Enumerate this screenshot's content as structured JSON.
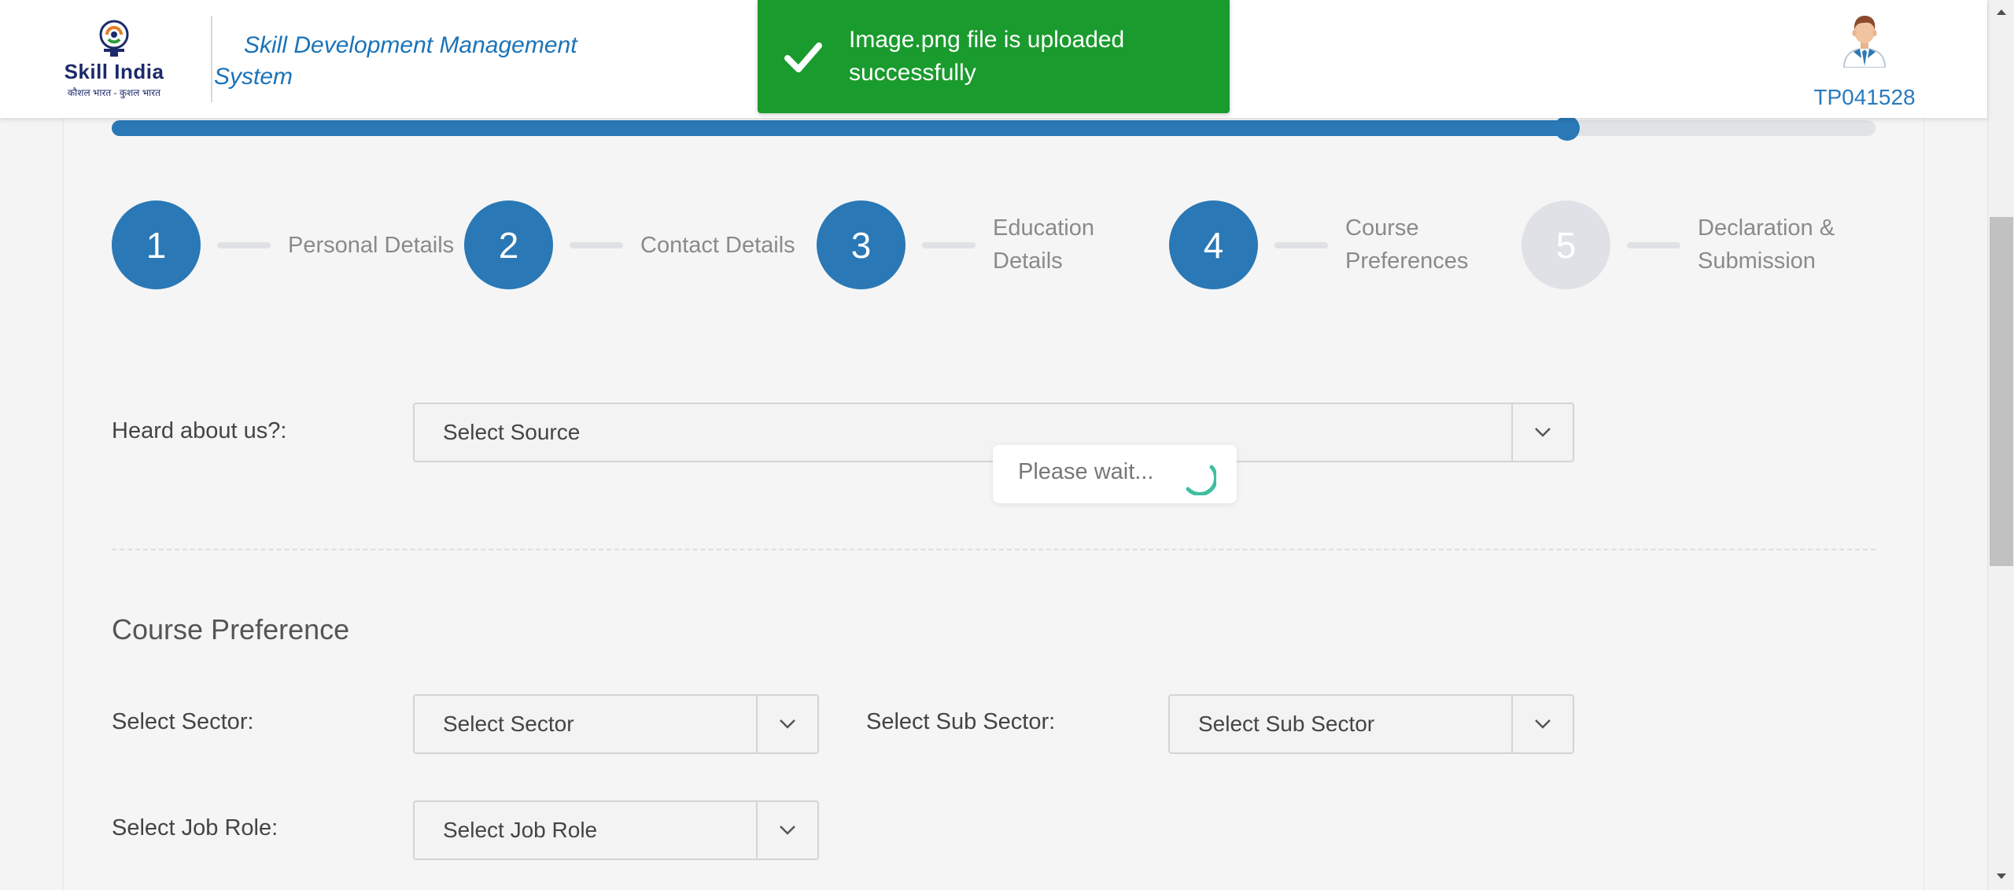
{
  "header": {
    "logo_title": "Skill India",
    "logo_subtitle": "कौशल भारत - कुशल भारत",
    "app_title": "Skill Development Management System",
    "user_id": "TP041528"
  },
  "toast": {
    "message": "Image.png file is uploaded successfully",
    "color": "#1a9b2e"
  },
  "progress": {
    "value_percent": 82.5,
    "color": "#2a78b5"
  },
  "steps": [
    {
      "number": "1",
      "label": "Personal Details",
      "state": "done"
    },
    {
      "number": "2",
      "label": "Contact Details",
      "state": "done"
    },
    {
      "number": "3",
      "label": "Education Details",
      "state": "done"
    },
    {
      "number": "4",
      "label": "Course Preferences",
      "state": "active"
    },
    {
      "number": "5",
      "label": "Declaration & Submission",
      "state": "pending"
    }
  ],
  "form": {
    "heard_about_label": "Heard about us?:",
    "heard_about_value": "Select Source",
    "section_title": "Course Preference",
    "sector_label": "Select Sector:",
    "sector_value": "Select Sector",
    "sub_sector_label": "Select Sub Sector:",
    "sub_sector_value": "Select Sub Sector",
    "job_role_label": "Select Job Role:",
    "job_role_value": "Select Job Role"
  },
  "loading": {
    "text": "Please wait..."
  },
  "icons": {
    "toast": "checkmark-icon",
    "dropdown": "chevron-down-icon",
    "avatar": "user-avatar-icon",
    "spinner": "spinner-icon"
  }
}
